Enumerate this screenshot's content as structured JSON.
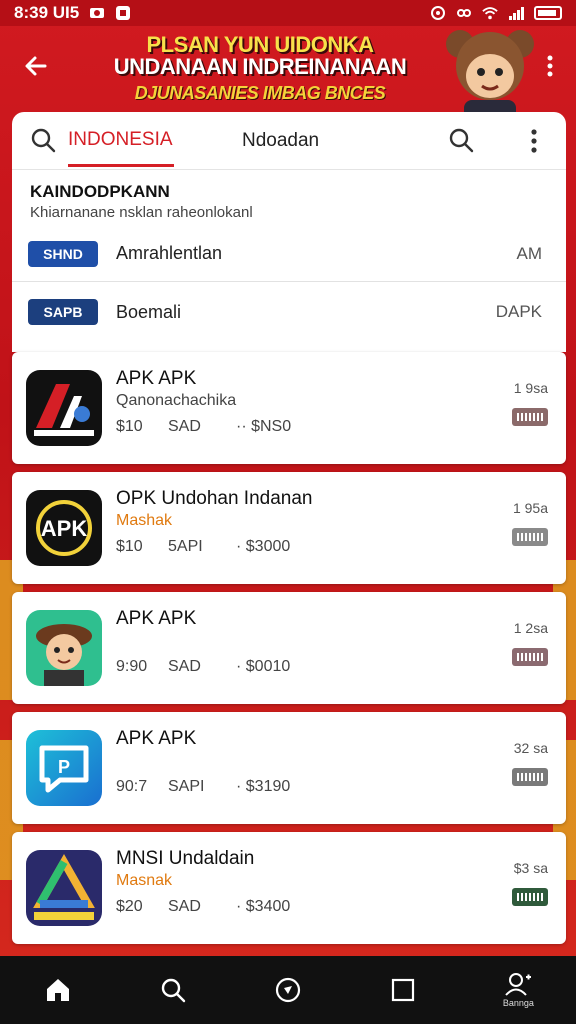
{
  "status_bar": {
    "time": "8:39 UI5",
    "icons": [
      "notification-icon",
      "app-icon",
      "alarm-icon",
      "wifi-icon",
      "signal-icon",
      "battery-icon"
    ]
  },
  "header": {
    "line1": "PLSAN YUN UIDONKA",
    "line2": "UNDANAAN INDREINANAAN",
    "line3": "DJUNASANIES IMBAG BNCES"
  },
  "tabs": {
    "active": "INDONESIA",
    "second": "Ndoadan"
  },
  "section": {
    "title": "KAINDODPKANN",
    "subtitle": "Khiarnanane nsklan raheonlokanl"
  },
  "categories": [
    {
      "badge": "SHND",
      "name": "Amrahlentlan",
      "right": "AM",
      "color": "#1f4fa8"
    },
    {
      "badge": "SAPB",
      "name": "Boemali",
      "right": "DAPK",
      "color": "#1c3f7e"
    }
  ],
  "apps": [
    {
      "title": "APK APK",
      "subtitle": "Qanonachachika",
      "sub_style": "grey",
      "m1": "$10",
      "m2": "SAD",
      "m3": "·· $NS0",
      "right": "1 9sa",
      "tag_color": "#8b6a6a",
      "icon": "robot-logo-icon"
    },
    {
      "title": "OPK Undohan Indanan",
      "subtitle": "Mashak",
      "sub_style": "orange",
      "m1": "$10",
      "m2": "5API",
      "m3": "· $3000",
      "right": "1 95a",
      "tag_color": "#8a8a8a",
      "icon": "apk-logo-icon"
    },
    {
      "title": "APK APK",
      "subtitle": "",
      "sub_style": "grey",
      "m1": "9:90",
      "m2": "SAD",
      "m3": "· $0010",
      "right": "1 2sa",
      "tag_color": "#8b6a70",
      "icon": "mascot-icon"
    },
    {
      "title": "APK APK",
      "subtitle": "",
      "sub_style": "grey",
      "m1": "90:7",
      "m2": "SAPI",
      "m3": "· $3190",
      "right": "32 sa",
      "tag_color": "#7a7a7a",
      "icon": "chat-bubble-icon"
    },
    {
      "title": "MNSI Undaldain",
      "subtitle": "Masnak",
      "sub_style": "orange",
      "m1": "$20",
      "m2": "SAD",
      "m3": "· $3400",
      "right": "$3 sa",
      "tag_color": "#2f5a3b",
      "icon": "drive-logo-icon"
    }
  ],
  "bottom_nav": {
    "items": [
      "home-icon",
      "search-icon",
      "location-icon",
      "square-icon",
      "profile-icon"
    ],
    "profile_label": "Bannga"
  }
}
